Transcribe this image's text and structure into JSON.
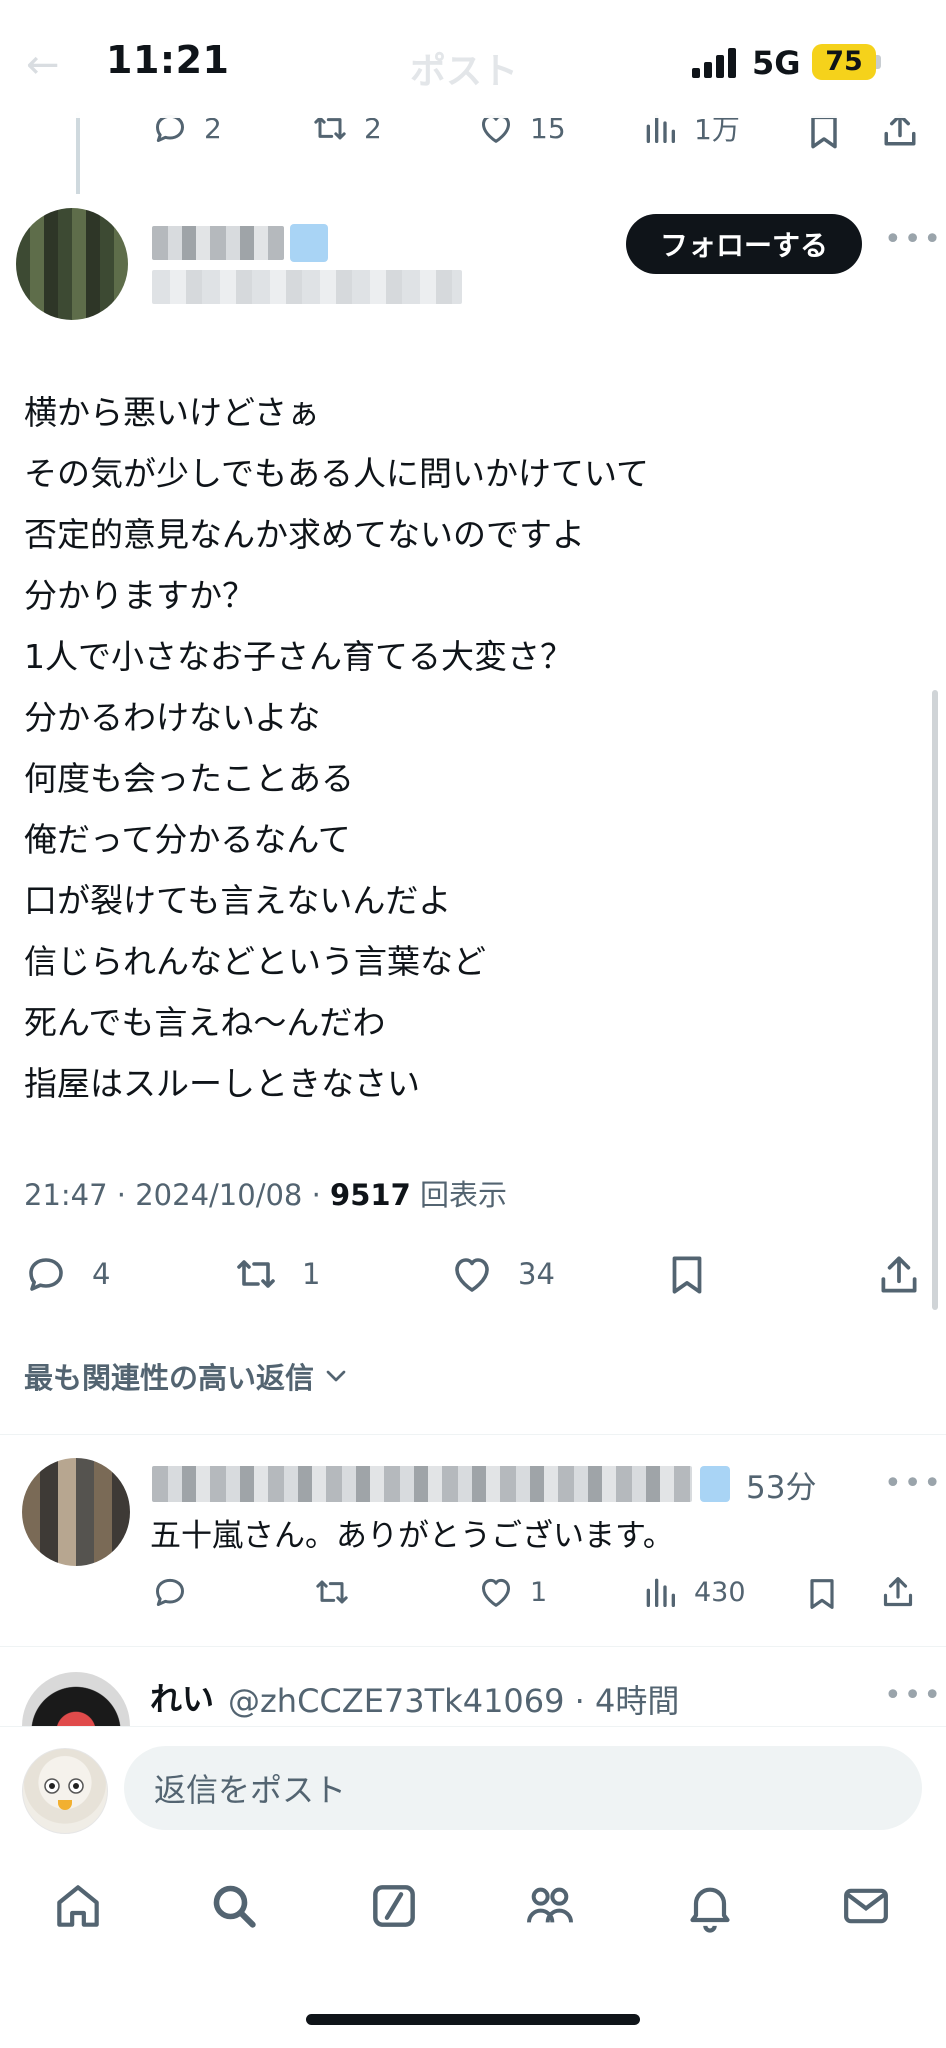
{
  "status_bar": {
    "time": "11:21",
    "network": "5G",
    "battery": "75"
  },
  "header": {
    "back_icon": "arrow-left-icon",
    "title": "ポスト"
  },
  "parent_post_stats": {
    "replies": "2",
    "reposts": "2",
    "likes": "15",
    "views": "1万"
  },
  "author": {
    "follow_label": "フォローする"
  },
  "tweet": {
    "lines": [
      "横から悪いけどさぁ",
      "その気が少しでもある人に問いかけていて",
      "否定的意見なんか求めてないのですよ",
      "分かりますか？",
      "1人で小さなお子さん育てる大変さ？",
      "分かるわけないよな",
      "何度も会ったことある",
      "俺だって分かるなんて",
      "口が裂けても言えないんだよ",
      "信じられんなどという言葉など",
      "死んでも言えね〜んだわ",
      "指屋はスルーしときなさい"
    ],
    "time_date": "21:47 · 2024/10/08 · ",
    "views_count": "9517",
    "views_label": "回表示",
    "replies": "4",
    "reposts": "1",
    "likes": "34"
  },
  "sort_label": "最も関連性の高い返信",
  "replies": [
    {
      "time": "53分",
      "text": "五十嵐さん。ありがとうございます。",
      "replies": "",
      "reposts": "",
      "likes": "1",
      "views": "430"
    },
    {
      "name": "れい",
      "handle": "@zhCCZE73Tk41069 · 4時間"
    }
  ],
  "composer": {
    "placeholder": "返信をポスト"
  },
  "tab_bar": [
    "home-icon",
    "search-icon",
    "grok-icon",
    "communities-icon",
    "notifications-icon",
    "messages-icon"
  ],
  "colors": {
    "text": "#0f1419",
    "muted": "#536471",
    "battery": "#f5d21b",
    "verified": "#1d9bf0"
  }
}
